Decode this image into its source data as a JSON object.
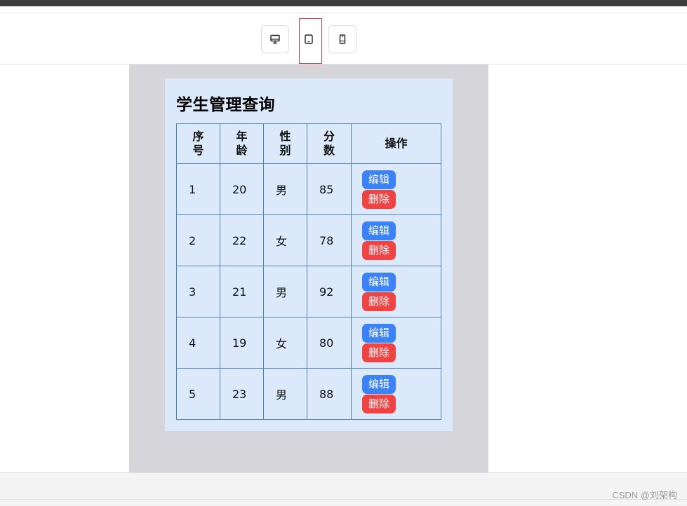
{
  "toolbar": {
    "devices": [
      {
        "name": "desktop",
        "icon": "monitor-icon"
      },
      {
        "name": "tablet",
        "icon": "tablet-icon",
        "selected": true
      },
      {
        "name": "mobile",
        "icon": "phone-icon"
      }
    ]
  },
  "card": {
    "title": "学生管理查询"
  },
  "table": {
    "headers": [
      "序号",
      "年龄",
      "性别",
      "分数",
      "操作"
    ],
    "rows": [
      {
        "id": "1",
        "age": "20",
        "gender": "男",
        "score": "85",
        "edit": "编辑",
        "delete": "删除"
      },
      {
        "id": "2",
        "age": "22",
        "gender": "女",
        "score": "78",
        "edit": "编辑",
        "delete": "删除"
      },
      {
        "id": "3",
        "age": "21",
        "gender": "男",
        "score": "92",
        "edit": "编辑",
        "delete": "删除"
      },
      {
        "id": "4",
        "age": "19",
        "gender": "女",
        "score": "80",
        "edit": "编辑",
        "delete": "删除"
      },
      {
        "id": "5",
        "age": "23",
        "gender": "男",
        "score": "88",
        "edit": "编辑",
        "delete": "删除"
      }
    ]
  },
  "colors": {
    "edit_button": "#3b82f6",
    "delete_button": "#ef4444",
    "card_background": "#dbe9fb",
    "table_border": "#4a86b8"
  },
  "watermark": "CSDN @刘架构"
}
